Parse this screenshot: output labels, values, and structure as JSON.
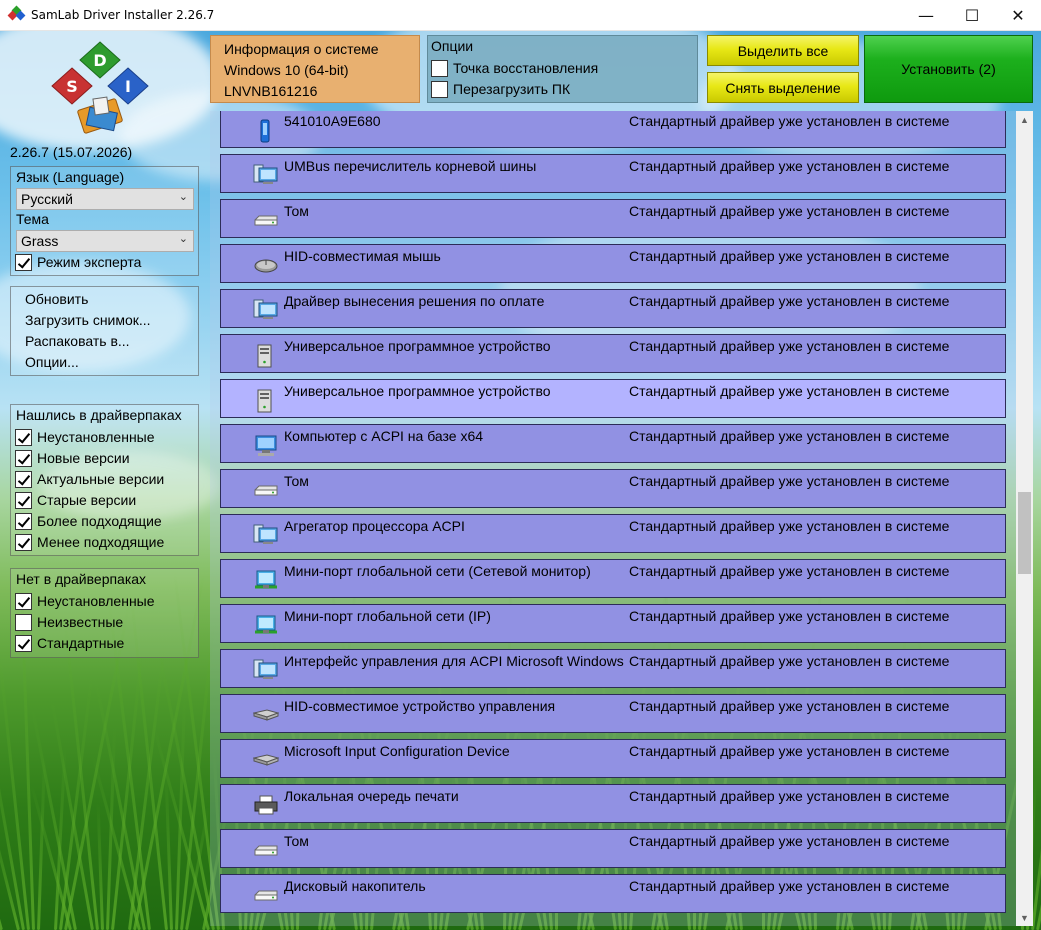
{
  "window": {
    "title": "SamLab Driver Installer 2.26.7"
  },
  "window_controls": {
    "minimize": "—",
    "maximize": "☐",
    "close": "✕"
  },
  "sidebar": {
    "version": "2.26.7 (15.07.2026)",
    "language_label": "Язык (Language)",
    "language_value": "Русский",
    "theme_label": "Тема",
    "theme_value": "Grass",
    "expert_mode": {
      "label": "Режим эксперта",
      "checked": true
    },
    "menu": [
      "Обновить",
      "Загрузить снимок...",
      "Распаковать в...",
      "Опции..."
    ],
    "found_group": {
      "title": "Нашлись в драйверпаках",
      "items": [
        {
          "label": "Неустановленные",
          "checked": true
        },
        {
          "label": "Новые версии",
          "checked": true
        },
        {
          "label": "Актуальные версии",
          "checked": true
        },
        {
          "label": "Старые версии",
          "checked": true
        },
        {
          "label": "Более подходящие",
          "checked": true
        },
        {
          "label": "Менее подходящие",
          "checked": true
        }
      ]
    },
    "notfound_group": {
      "title": "Нет в драйверпаках",
      "items": [
        {
          "label": "Неустановленные",
          "checked": true
        },
        {
          "label": "Неизвестные",
          "checked": false
        },
        {
          "label": "Стандартные",
          "checked": true
        }
      ]
    }
  },
  "sysinfo": {
    "title": "Информация о системе",
    "os": "Windows 10 (64-bit)",
    "pc_name": "LNVNB161216"
  },
  "options": {
    "title": "Опции",
    "restore_point": {
      "label": "Точка восстановления",
      "checked": false
    },
    "reboot": {
      "label": "Перезагрузить ПК",
      "checked": false
    }
  },
  "buttons": {
    "select_all": "Выделить все",
    "deselect": "Снять выделение",
    "install": "Установить (2)"
  },
  "devices": [
    {
      "name": "541010A9E680",
      "status": "Стандартный драйвер уже установлен в системе",
      "icon": "usb-drive-icon",
      "highlighted": false
    },
    {
      "name": "UMBus перечислитель корневой шины",
      "status": "Стандартный драйвер уже установлен в системе",
      "icon": "system-device-icon",
      "highlighted": false
    },
    {
      "name": "Том",
      "status": "Стандартный драйвер уже установлен в системе",
      "icon": "disk-drive-icon",
      "highlighted": false
    },
    {
      "name": "HID-совместимая мышь",
      "status": "Стандартный драйвер уже установлен в системе",
      "icon": "mouse-icon",
      "highlighted": false
    },
    {
      "name": "Драйвер вынесения решения по оплате",
      "status": "Стандартный драйвер уже установлен в системе",
      "icon": "system-device-icon",
      "highlighted": false
    },
    {
      "name": "Универсальное программное устройство",
      "status": "Стандартный драйвер уже установлен в системе",
      "icon": "computer-tower-icon",
      "highlighted": false
    },
    {
      "name": "Универсальное программное устройство",
      "status": "Стандартный драйвер уже установлен в системе",
      "icon": "computer-tower-icon",
      "highlighted": true
    },
    {
      "name": "Компьютер с ACPI на базе x64",
      "status": "Стандартный драйвер уже установлен в системе",
      "icon": "computer-icon",
      "highlighted": false
    },
    {
      "name": "Том",
      "status": "Стандартный драйвер уже установлен в системе",
      "icon": "disk-drive-icon",
      "highlighted": false
    },
    {
      "name": "Агрегатор процессора ACPI",
      "status": "Стандартный драйвер уже установлен в системе",
      "icon": "system-device-icon",
      "highlighted": false
    },
    {
      "name": "Мини-порт глобальной сети (Сетевой монитор)",
      "status": "Стандартный драйвер уже установлен в системе",
      "icon": "network-adapter-icon",
      "highlighted": false
    },
    {
      "name": "Мини-порт глобальной сети (IP)",
      "status": "Стандартный драйвер уже установлен в системе",
      "icon": "network-adapter-icon",
      "highlighted": false
    },
    {
      "name": "Интерфейс управления для ACPI Microsoft Windows",
      "status": "Стандартный драйвер уже установлен в системе",
      "icon": "system-device-icon",
      "highlighted": false
    },
    {
      "name": "HID-совместимое устройство управления",
      "status": "Стандартный драйвер уже установлен в системе",
      "icon": "hid-device-icon",
      "highlighted": false
    },
    {
      "name": "Microsoft Input Configuration Device",
      "status": "Стандартный драйвер уже установлен в системе",
      "icon": "hid-device-icon",
      "highlighted": false
    },
    {
      "name": "Локальная очередь печати",
      "status": "Стандартный драйвер уже установлен в системе",
      "icon": "printer-icon",
      "highlighted": false
    },
    {
      "name": "Том",
      "status": "Стандартный драйвер уже установлен в системе",
      "icon": "disk-drive-icon",
      "highlighted": false
    },
    {
      "name": "Дисковый накопитель",
      "status": "Стандартный драйвер уже установлен в системе",
      "icon": "disk-drive-icon",
      "highlighted": false
    }
  ]
}
